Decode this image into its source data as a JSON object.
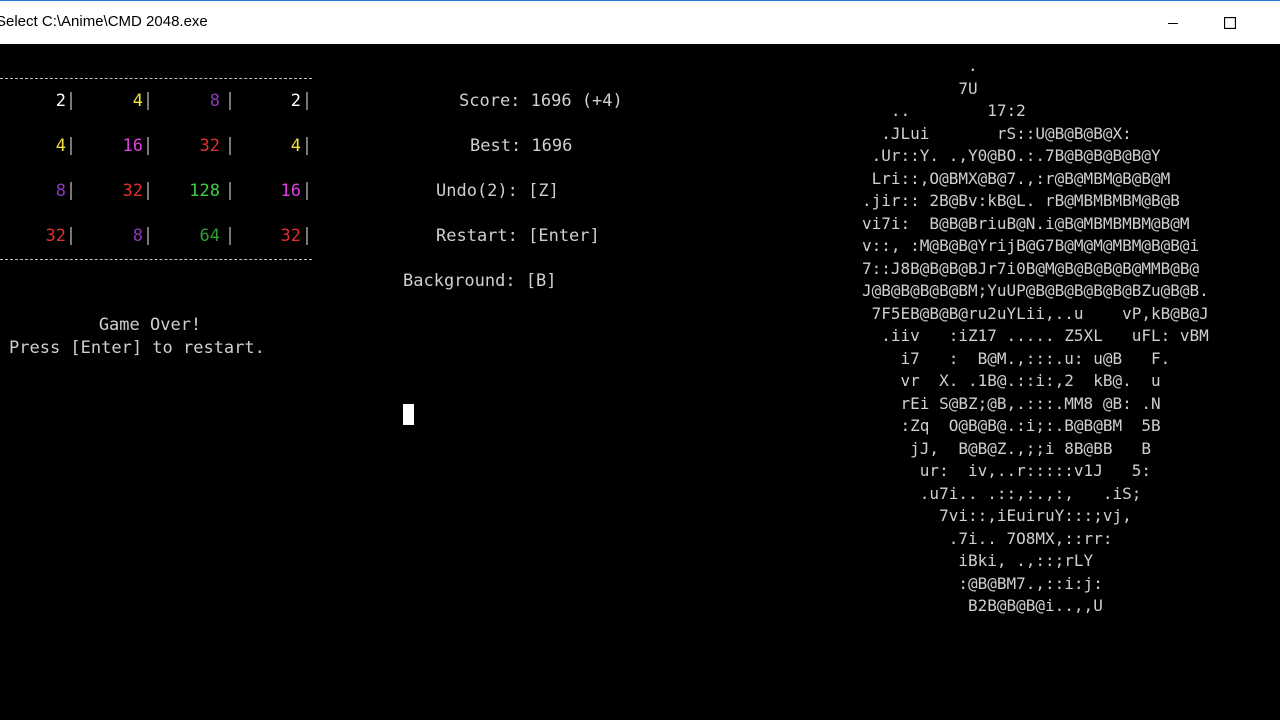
{
  "window": {
    "title": "Select C:\\Anime\\CMD 2048.exe",
    "min_glyph": "—",
    "max_glyph": "☐"
  },
  "board": {
    "rows": [
      [
        {
          "v": "2",
          "c": "#ffffff"
        },
        {
          "v": "4",
          "c": "#f0e040"
        },
        {
          "v": "8",
          "c": "#8a3ab9"
        },
        {
          "v": "2",
          "c": "#ffffff"
        }
      ],
      [
        {
          "v": "4",
          "c": "#f0e040"
        },
        {
          "v": "16",
          "c": "#e040e0"
        },
        {
          "v": "32",
          "c": "#e03030"
        },
        {
          "v": "4",
          "c": "#f0e040"
        }
      ],
      [
        {
          "v": "8",
          "c": "#8a3ab9"
        },
        {
          "v": "32",
          "c": "#e03030"
        },
        {
          "v": "128",
          "c": "#40d040"
        },
        {
          "v": "16",
          "c": "#e040e0"
        }
      ],
      [
        {
          "v": "32",
          "c": "#e03030"
        },
        {
          "v": "8",
          "c": "#8a3ab9"
        },
        {
          "v": "64",
          "c": "#30a030"
        },
        {
          "v": "32",
          "c": "#e03030"
        }
      ]
    ]
  },
  "info": {
    "score": "Score: 1696 (+4)",
    "best": "Best: 1696",
    "undo": "Undo(2): [Z]",
    "restart": "Restart: [Enter]",
    "background": "Background: [B]"
  },
  "game_over": {
    "line1": "Game Over!",
    "line2": "Press [Enter] to restart."
  },
  "ascii_art": [
    "           .",
    "          7U",
    "   ..        17:2",
    "  .JLui       rS::U@B@B@B@X:",
    " .Ur::Y. .,Y0@BO.:.7B@B@B@B@B@Y",
    " Lri::,O@BMX@B@7.,:r@B@MBM@B@B@M",
    ".jir:: 2B@Bv:kB@L. rB@MBMBMBM@B@B",
    "vi7i:  B@B@BriuB@N.i@B@MBMBMBM@B@M",
    "v::, :M@B@B@YrijB@G7B@M@M@MBM@B@B@i",
    "7::J8B@B@B@BJr7i0B@M@B@B@B@B@MMB@B@",
    "J@B@B@B@B@BM;YuUP@B@B@B@B@B@BZu@B@B.",
    " 7F5EB@B@B@ru2uYLii,..u    vP,kB@B@J",
    "  .iiv   :iZ17 ..... Z5XL   uFL: vBM",
    "    i7   :  B@M.,:::.u: u@B   F.",
    "    vr  X. .1B@.::i:,2  kB@.  u",
    "    rEi S@BZ;@B,.:::.MM8 @B: .N",
    "    :Zq  O@B@B@.:i;:.B@B@BM  5B",
    "     jJ,  B@B@Z.,;;i 8B@BB   B",
    "      ur:  iv,..r:::::v1J   5:",
    "      .u7i.. .::,:.,:,   .iS;",
    "        7vi::,iEuiruY:::;vj,",
    "         .7i.. 7O8MX,::rr:",
    "          iBki, .,::;rLY",
    "          :@B@BM7.,::i:j:",
    "           B2B@B@B@i..,,U"
  ]
}
